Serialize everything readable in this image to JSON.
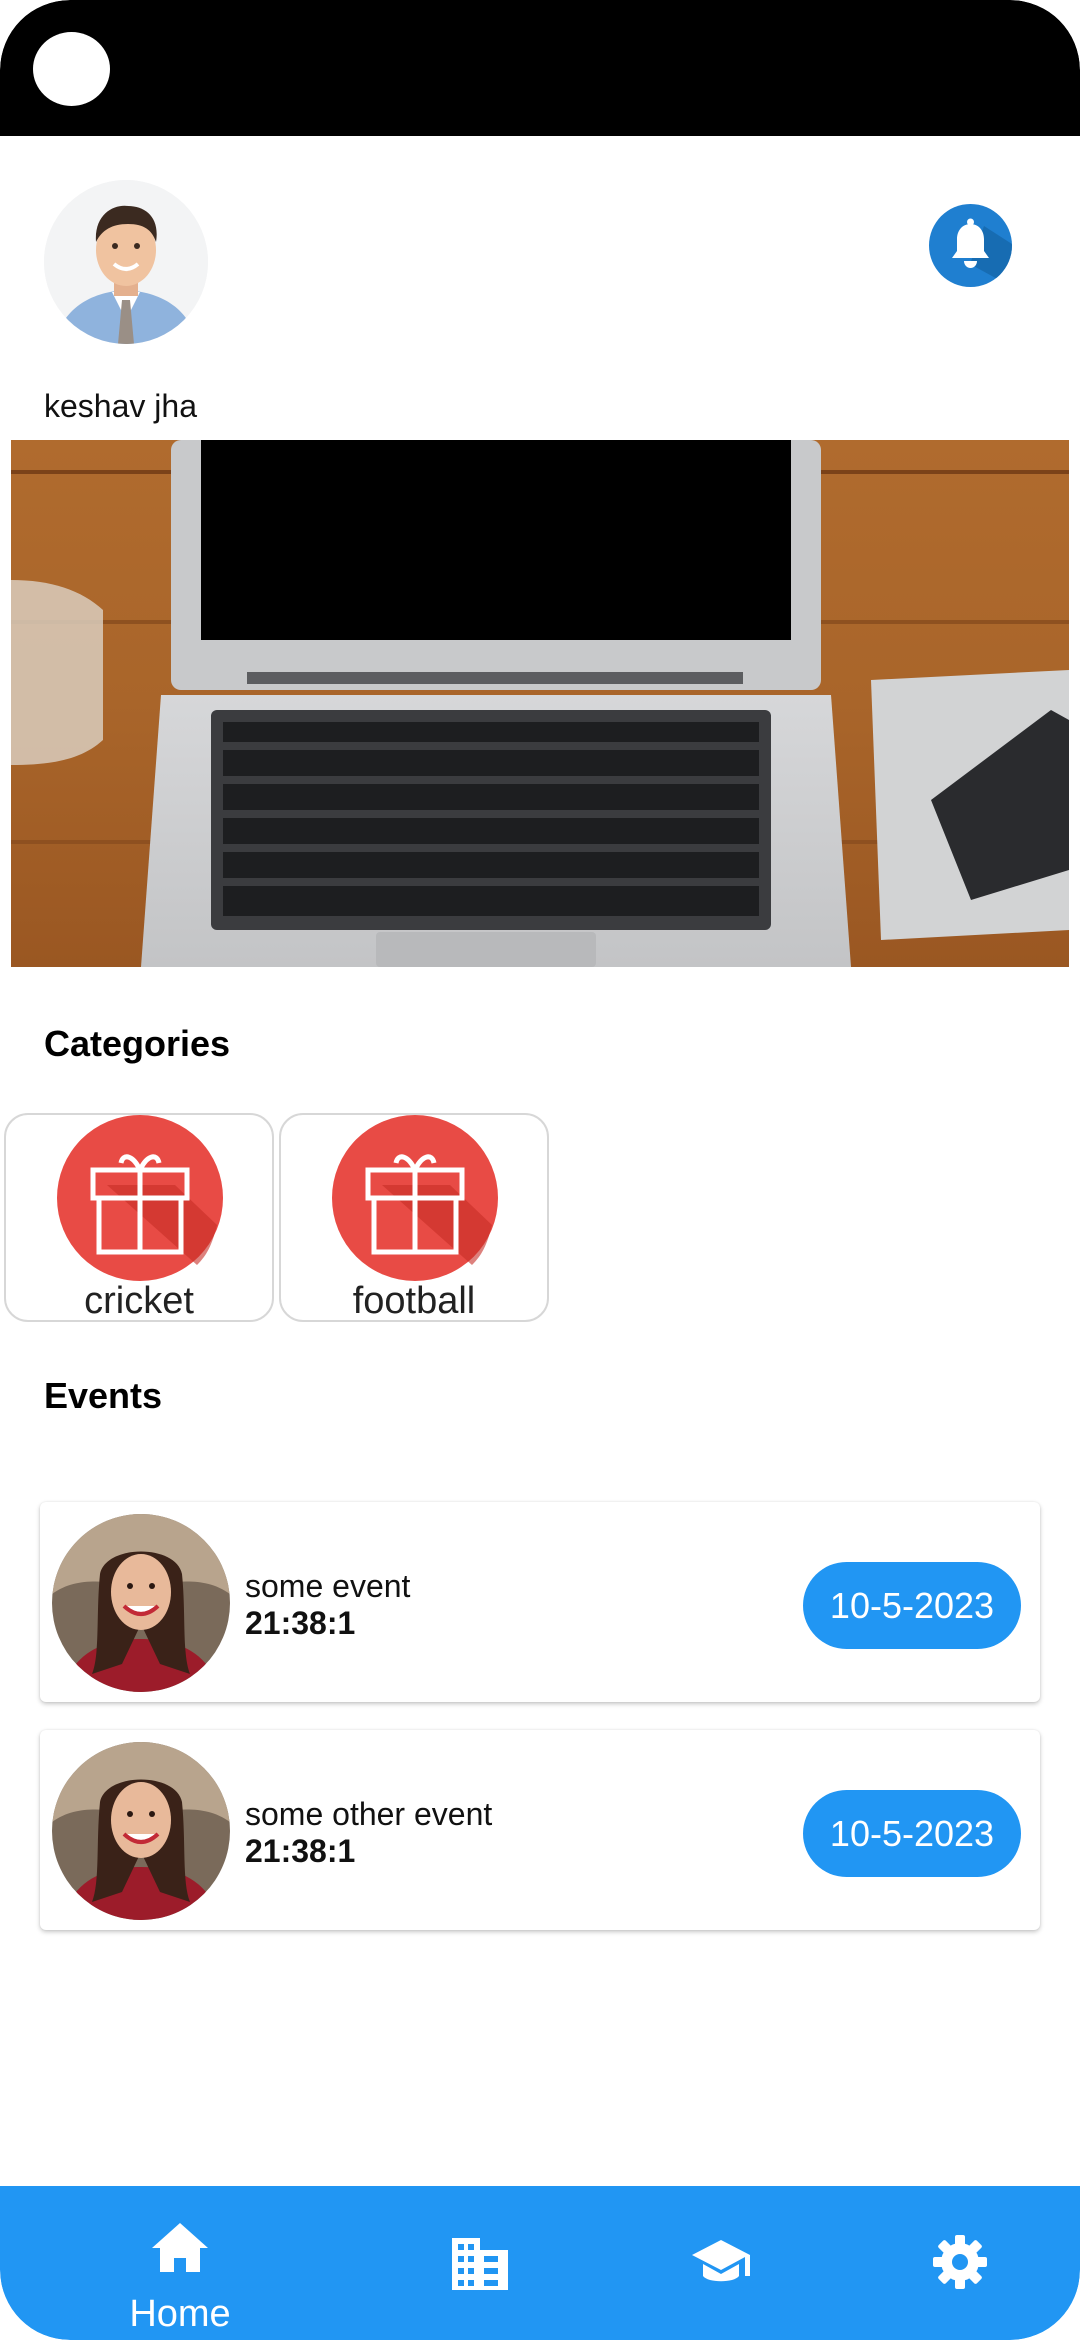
{
  "header": {
    "user_name": "keshav jha"
  },
  "sections": {
    "categories_title": "Categories",
    "events_title": "Events"
  },
  "categories": [
    {
      "label": "cricket",
      "icon": "gift-icon"
    },
    {
      "label": "football",
      "icon": "gift-icon"
    }
  ],
  "events": [
    {
      "name": "some event",
      "time": "21:38:1",
      "date": "10-5-2023"
    },
    {
      "name": "some other event",
      "time": "21:38:1",
      "date": "10-5-2023"
    }
  ],
  "bottom_nav": {
    "home_label": "Home",
    "items": [
      "home-icon",
      "building-icon",
      "graduation-cap-icon",
      "gear-icon"
    ]
  },
  "colors": {
    "accent": "#2196f3",
    "bell": "#1f7fd0",
    "category_icon": "#e53935"
  }
}
